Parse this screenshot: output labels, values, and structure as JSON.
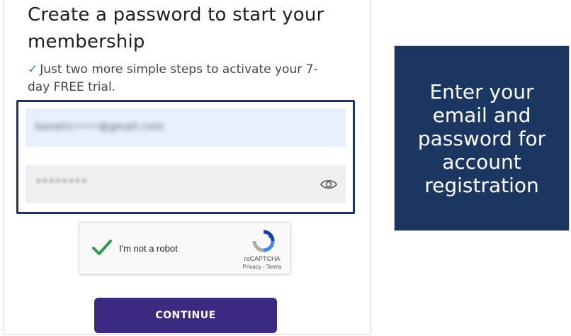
{
  "form": {
    "heading": "Create a password to start your membership",
    "check_mark": "✓",
    "subtext": "Just two more simple steps to activate your 7-day FREE trial.",
    "email_value": "kanetic••••@gmail.com",
    "password_value": "••••••••",
    "continue_label": "CONTINUE"
  },
  "captcha": {
    "label": "I'm not a robot",
    "brand": "reCAPTCHA",
    "links": "Privacy - Terms"
  },
  "callout": {
    "text": "Enter your email and password for account registration"
  },
  "colors": {
    "callout_bg": "#1b3660",
    "button_bg": "#3b2a80",
    "check_green": "#2e9d4f",
    "email_bg": "#e8f0fe"
  }
}
